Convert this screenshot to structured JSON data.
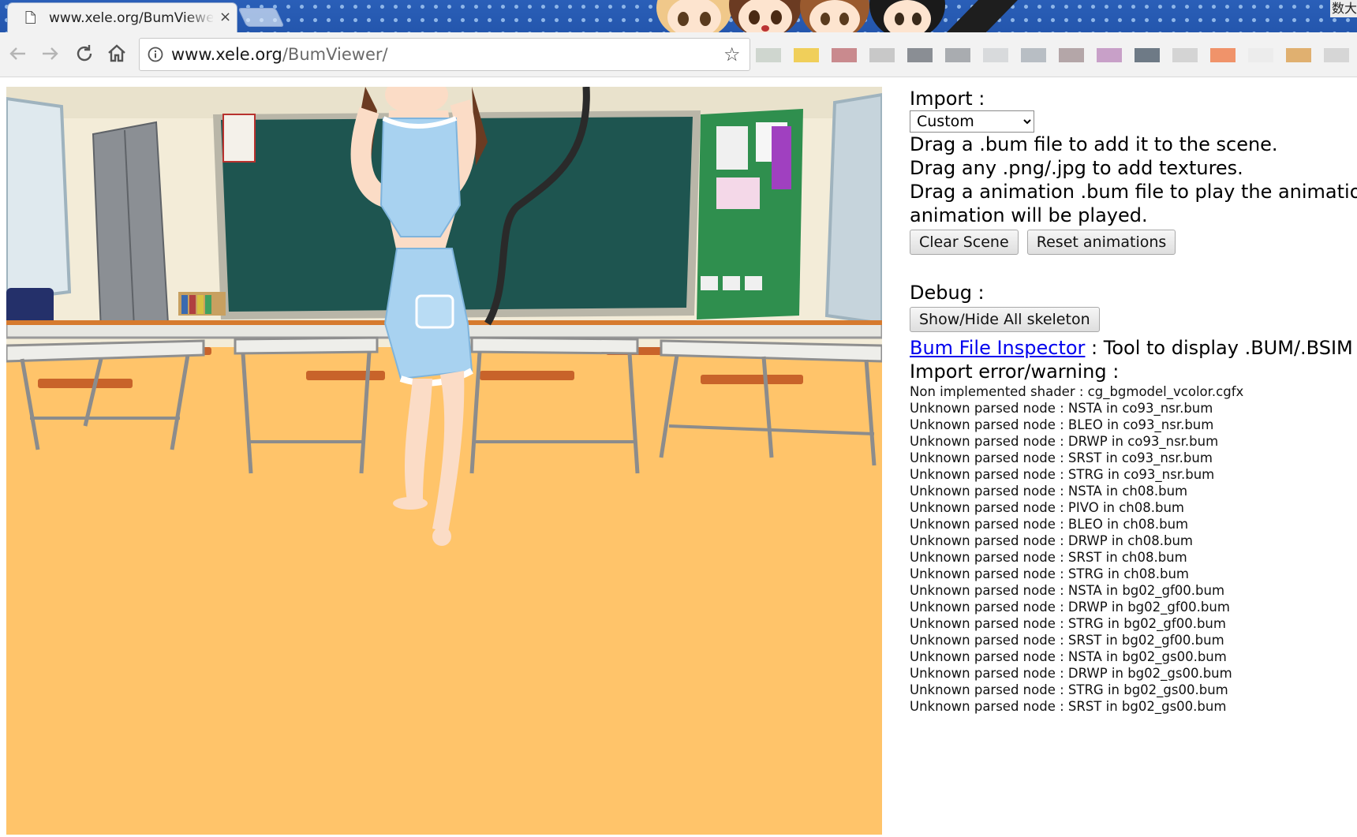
{
  "browser": {
    "tab_title": "www.xele.org/BumViewer/",
    "tab_close": "×",
    "url_host": "www.xele.org",
    "url_path": "/BumViewer/",
    "ime_indicator": "数大"
  },
  "panel": {
    "import_heading": "Import :",
    "import_select_value": "Custom",
    "instructions": [
      "Drag a .bum file to add it to the scene.",
      "Drag any .png/.jpg to add textures.",
      "Drag a animation .bum file to play the animation. The",
      "animation will be played."
    ],
    "clear_scene_label": "Clear Scene",
    "reset_animations_label": "Reset animations",
    "debug_heading": "Debug :",
    "skeleton_button_label": "Show/Hide All skeleton",
    "inspector_link": "Bum File Inspector",
    "inspector_desc": " : Tool to display .BUM/.BSIM data",
    "error_heading": "Import error/warning :",
    "log_lines": [
      "Non implemented shader : cg_bgmodel_vcolor.cgfx",
      "Unknown parsed node : NSTA in co93_nsr.bum",
      "Unknown parsed node : BLEO in co93_nsr.bum",
      "Unknown parsed node : DRWP in co93_nsr.bum",
      "Unknown parsed node : SRST in co93_nsr.bum",
      "Unknown parsed node : STRG in co93_nsr.bum",
      "Unknown parsed node : NSTA in ch08.bum",
      "Unknown parsed node : PIVO in ch08.bum",
      "Unknown parsed node : BLEO in ch08.bum",
      "Unknown parsed node : DRWP in ch08.bum",
      "Unknown parsed node : SRST in ch08.bum",
      "Unknown parsed node : STRG in ch08.bum",
      "Unknown parsed node : NSTA in bg02_gf00.bum",
      "Unknown parsed node : DRWP in bg02_gf00.bum",
      "Unknown parsed node : STRG in bg02_gf00.bum",
      "Unknown parsed node : SRST in bg02_gf00.bum",
      "Unknown parsed node : NSTA in bg02_gs00.bum",
      "Unknown parsed node : DRWP in bg02_gs00.bum",
      "Unknown parsed node : STRG in bg02_gs00.bum",
      "Unknown parsed node : SRST in bg02_gs00.bum"
    ]
  },
  "colors": {
    "floor": "#ffc46a",
    "chalkboard": "#1e5550",
    "wall": "#f3ecd8",
    "link": "#0000ee"
  }
}
